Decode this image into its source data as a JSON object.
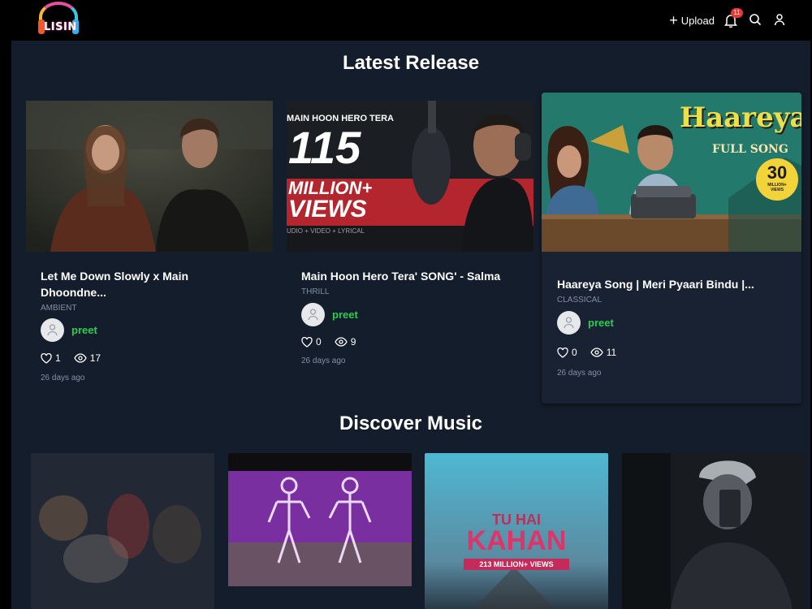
{
  "header": {
    "logo_text": "LISIN",
    "upload_label": "Upload",
    "notification_count": "11"
  },
  "latest": {
    "title": "Latest Release",
    "cards": [
      {
        "title_line1": "Let Me Down Slowly x Main",
        "title_line2": "Dhoondne...",
        "genre": "AMBIENT",
        "user": "preet",
        "likes": "1",
        "views": "17",
        "ago": "26 days ago"
      },
      {
        "thumb_top": "MAIN HOON HERO TERA",
        "thumb_big": "115",
        "thumb_mid": "MILLION+",
        "thumb_views": "VIEWS",
        "thumb_sub": "UDIO + VIDEO + LYRICAL",
        "title_line1": "Main Hoon Hero Tera' SONG' - Salma",
        "genre": "THRILL",
        "user": "preet",
        "likes": "0",
        "views": "9",
        "ago": "26 days ago"
      },
      {
        "thumb_title": "Haareya",
        "thumb_sub": "FULL SONG",
        "thumb_num": "30",
        "thumb_badge_text": "MILLION+ VIEWS",
        "title_line1": "Haareya Song | Meri Pyaari Bindu |...",
        "genre": "CLASSICAL",
        "user": "preet",
        "likes": "0",
        "views": "11",
        "ago": "26 days ago"
      }
    ]
  },
  "discover": {
    "title": "Discover Music",
    "cards": [
      {},
      {},
      {
        "line1": "TU HAI",
        "line2": "KAHAN",
        "views": "213 MILLION+ VIEWS"
      },
      {}
    ]
  },
  "colors": {
    "background": "#141d2b",
    "accent_green": "#2ecc52",
    "badge_red": "#e53935"
  }
}
